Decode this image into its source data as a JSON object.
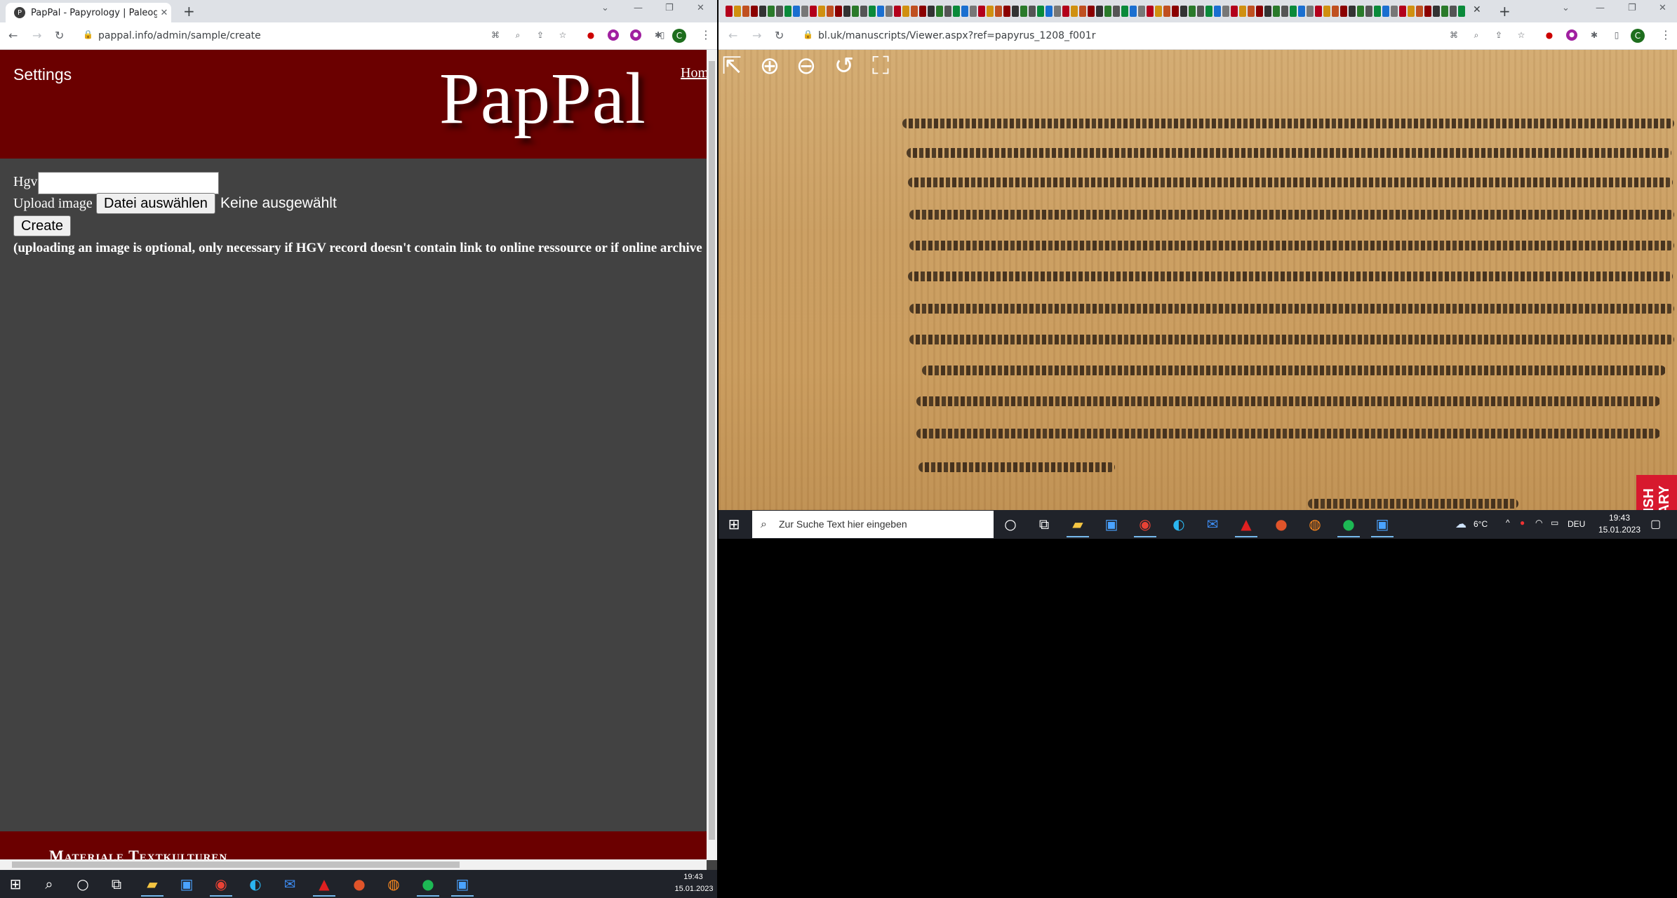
{
  "left_browser": {
    "tab_title": "PapPal - Papyrology | Paleograph",
    "tab_favicon": "P",
    "url": "pappal.info/admin/sample/create",
    "profile_initial": "C"
  },
  "page": {
    "settings_label": "Settings",
    "logo_text": "PapPal",
    "home_link": "Home",
    "hgv_label": "Hgv",
    "hgv_value": "",
    "upload_label": "Upload image",
    "choose_file_button": "Datei auswählen",
    "no_file_text": "Keine ausgewählt",
    "create_button": "Create",
    "note": "(uploading an image is optional, only necessary if HGV record doesn't contain link to online ressource or if online archive",
    "footer_text": "Materiale Textkulturen"
  },
  "right_browser": {
    "url": "bl.uk/manuscripts/Viewer.aspx?ref=papyrus_1208_f001r",
    "profile_initial": "C",
    "viewer_tools": [
      "exit-icon",
      "zoom-in-icon",
      "zoom-out-icon",
      "rotate-icon",
      "fullscreen-icon"
    ],
    "badge_text": "BRITISH LIBRARY"
  },
  "right_taskbar": {
    "search_placeholder": "Zur Suche Text hier eingeben",
    "weather": "6°C",
    "language": "DEU",
    "time": "19:43",
    "date": "15.01.2023"
  },
  "main_taskbar": {
    "time": "19:43",
    "date": "15.01.2023"
  },
  "colors": {
    "header_red": "#6b0000",
    "page_bg": "#424242",
    "taskbar": "#20232a",
    "british_library_red": "#d7192e"
  }
}
